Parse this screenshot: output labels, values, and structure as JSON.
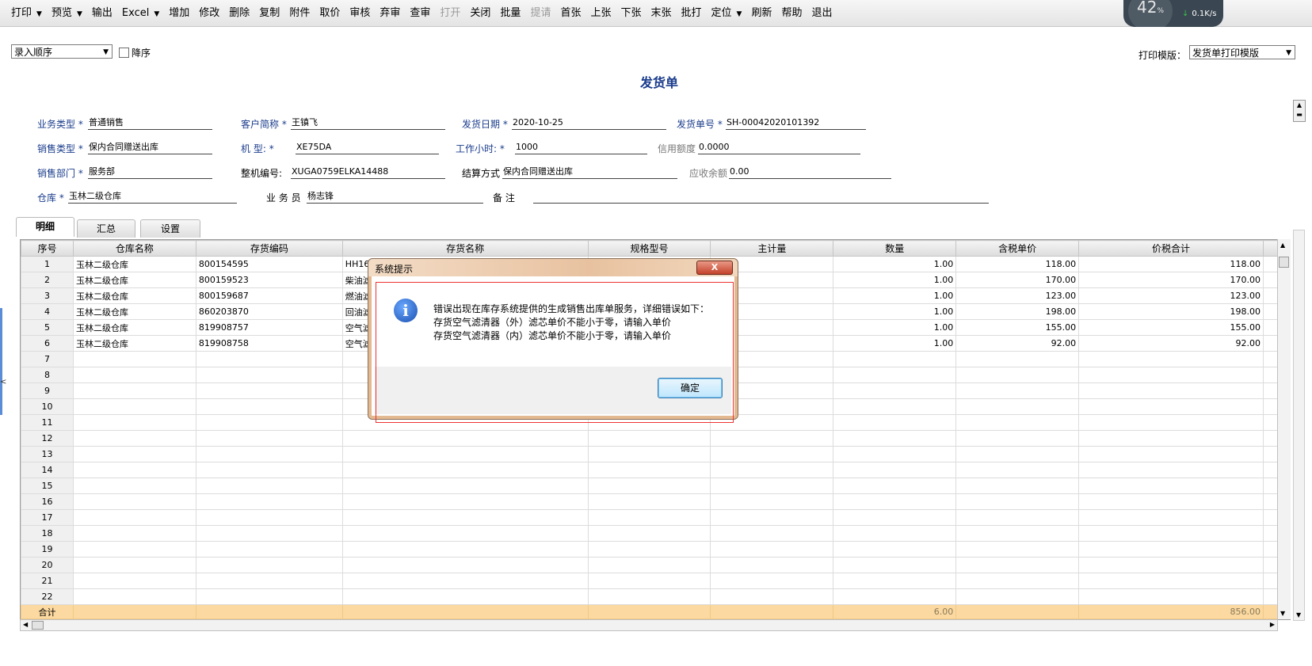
{
  "toolbar": {
    "items": [
      {
        "label": "打印",
        "dropdown": true,
        "disabled": false
      },
      {
        "label": "预览",
        "dropdown": true,
        "disabled": false
      },
      {
        "label": "输出",
        "dropdown": false,
        "disabled": false
      },
      {
        "label": "Excel",
        "dropdown": true,
        "disabled": false
      },
      {
        "label": "增加",
        "dropdown": false,
        "disabled": false
      },
      {
        "label": "修改",
        "dropdown": false,
        "disabled": false
      },
      {
        "label": "删除",
        "dropdown": false,
        "disabled": false
      },
      {
        "label": "复制",
        "dropdown": false,
        "disabled": false
      },
      {
        "label": "附件",
        "dropdown": false,
        "disabled": false
      },
      {
        "label": "取价",
        "dropdown": false,
        "disabled": false
      },
      {
        "label": "审核",
        "dropdown": false,
        "disabled": false
      },
      {
        "label": "弃审",
        "dropdown": false,
        "disabled": false
      },
      {
        "label": "查审",
        "dropdown": false,
        "disabled": false
      },
      {
        "label": "打开",
        "dropdown": false,
        "disabled": true
      },
      {
        "label": "关闭",
        "dropdown": false,
        "disabled": false
      },
      {
        "label": "批量",
        "dropdown": false,
        "disabled": false
      },
      {
        "label": "提请",
        "dropdown": false,
        "disabled": true
      },
      {
        "label": "首张",
        "dropdown": false,
        "disabled": false
      },
      {
        "label": "上张",
        "dropdown": false,
        "disabled": false
      },
      {
        "label": "下张",
        "dropdown": false,
        "disabled": false
      },
      {
        "label": "末张",
        "dropdown": false,
        "disabled": false
      },
      {
        "label": "批打",
        "dropdown": false,
        "disabled": false
      },
      {
        "label": "定位",
        "dropdown": true,
        "disabled": false
      },
      {
        "label": "刷新",
        "dropdown": false,
        "disabled": false
      },
      {
        "label": "帮助",
        "dropdown": false,
        "disabled": false
      },
      {
        "label": "退出",
        "dropdown": false,
        "disabled": false
      }
    ]
  },
  "speed_widget": {
    "percent": "42",
    "percent_unit": "%",
    "speed": "0.1K/s"
  },
  "header": {
    "sort_select": "录入顺序",
    "desc_checkbox": "降序",
    "title": "发货单",
    "print_template_label": "打印模版：",
    "print_template_value": "发货单打印模版"
  },
  "form": {
    "biz_type_label": "业务类型",
    "biz_type": "普通销售",
    "customer_label": "客户简称",
    "customer": "王镇飞",
    "ship_date_label": "发货日期",
    "ship_date": "2020-10-25",
    "ship_no_label": "发货单号",
    "ship_no": "SH-00042020101392",
    "sale_type_label": "销售类型",
    "sale_type": "保内合同赠送出库",
    "model_label": "机    型:",
    "model": "XE75DA",
    "hours_label": "工作小时:",
    "hours": "1000",
    "credit_label": "信用额度",
    "credit": "0.0000",
    "dept_label": "销售部门",
    "dept": "服务部",
    "machine_no_label": "整机编号:",
    "machine_no": "XUGA0759ELKA14488",
    "settle_label": "结算方式",
    "settle": "保内合同赠送出库",
    "receivable_label": "应收余额",
    "receivable": "0.00",
    "warehouse_label": "仓库",
    "warehouse": "玉林二级仓库",
    "staff_label": "业 务 员",
    "staff": "杨志锋",
    "remark_label": "备    注",
    "remark": ""
  },
  "tabs": [
    "明细",
    "汇总",
    "设置"
  ],
  "grid": {
    "columns": [
      "序号",
      "仓库名称",
      "存货编码",
      "存货名称",
      "规格型号",
      "主计量",
      "数量",
      "含税单价",
      "价税合计"
    ],
    "rows": [
      {
        "idx": "1",
        "wh": "玉林二级仓库",
        "code": "800154595",
        "name": "HH164",
        "spec": "",
        "unit": "",
        "qty": "1.00",
        "price": "118.00",
        "total": "118.00"
      },
      {
        "idx": "2",
        "wh": "玉林二级仓库",
        "code": "800159523",
        "name": "柴油滤",
        "spec": "",
        "unit": "",
        "qty": "1.00",
        "price": "170.00",
        "total": "170.00"
      },
      {
        "idx": "3",
        "wh": "玉林二级仓库",
        "code": "800159687",
        "name": "燃油滤",
        "spec": "",
        "unit": "",
        "qty": "1.00",
        "price": "123.00",
        "total": "123.00"
      },
      {
        "idx": "4",
        "wh": "玉林二级仓库",
        "code": "860203870",
        "name": "回油滤",
        "spec": "",
        "unit": "",
        "qty": "1.00",
        "price": "198.00",
        "total": "198.00"
      },
      {
        "idx": "5",
        "wh": "玉林二级仓库",
        "code": "819908757",
        "name": "空气滤",
        "spec": "",
        "unit": "",
        "qty": "1.00",
        "price": "155.00",
        "total": "155.00"
      },
      {
        "idx": "6",
        "wh": "玉林二级仓库",
        "code": "819908758",
        "name": "空气滤",
        "spec": "",
        "unit": "",
        "qty": "1.00",
        "price": "92.00",
        "total": "92.00"
      },
      {
        "idx": "7",
        "wh": "",
        "code": "",
        "name": "",
        "spec": "",
        "unit": "",
        "qty": "",
        "price": "",
        "total": ""
      },
      {
        "idx": "8",
        "wh": "",
        "code": "",
        "name": "",
        "spec": "",
        "unit": "",
        "qty": "",
        "price": "",
        "total": ""
      },
      {
        "idx": "9",
        "wh": "",
        "code": "",
        "name": "",
        "spec": "",
        "unit": "",
        "qty": "",
        "price": "",
        "total": ""
      },
      {
        "idx": "10",
        "wh": "",
        "code": "",
        "name": "",
        "spec": "",
        "unit": "",
        "qty": "",
        "price": "",
        "total": ""
      },
      {
        "idx": "11",
        "wh": "",
        "code": "",
        "name": "",
        "spec": "",
        "unit": "",
        "qty": "",
        "price": "",
        "total": ""
      },
      {
        "idx": "12",
        "wh": "",
        "code": "",
        "name": "",
        "spec": "",
        "unit": "",
        "qty": "",
        "price": "",
        "total": ""
      },
      {
        "idx": "13",
        "wh": "",
        "code": "",
        "name": "",
        "spec": "",
        "unit": "",
        "qty": "",
        "price": "",
        "total": ""
      },
      {
        "idx": "14",
        "wh": "",
        "code": "",
        "name": "",
        "spec": "",
        "unit": "",
        "qty": "",
        "price": "",
        "total": ""
      },
      {
        "idx": "15",
        "wh": "",
        "code": "",
        "name": "",
        "spec": "",
        "unit": "",
        "qty": "",
        "price": "",
        "total": ""
      },
      {
        "idx": "16",
        "wh": "",
        "code": "",
        "name": "",
        "spec": "",
        "unit": "",
        "qty": "",
        "price": "",
        "total": ""
      },
      {
        "idx": "17",
        "wh": "",
        "code": "",
        "name": "",
        "spec": "",
        "unit": "",
        "qty": "",
        "price": "",
        "total": ""
      },
      {
        "idx": "18",
        "wh": "",
        "code": "",
        "name": "",
        "spec": "",
        "unit": "",
        "qty": "",
        "price": "",
        "total": ""
      },
      {
        "idx": "19",
        "wh": "",
        "code": "",
        "name": "",
        "spec": "",
        "unit": "",
        "qty": "",
        "price": "",
        "total": ""
      },
      {
        "idx": "20",
        "wh": "",
        "code": "",
        "name": "",
        "spec": "",
        "unit": "",
        "qty": "",
        "price": "",
        "total": ""
      },
      {
        "idx": "21",
        "wh": "",
        "code": "",
        "name": "",
        "spec": "",
        "unit": "",
        "qty": "",
        "price": "",
        "total": ""
      },
      {
        "idx": "22",
        "wh": "",
        "code": "",
        "name": "",
        "spec": "",
        "unit": "",
        "qty": "",
        "price": "",
        "total": ""
      }
    ],
    "total_label": "合计",
    "total_qty": "6.00",
    "total_amount": "856.00"
  },
  "dialog": {
    "title": "系统提示",
    "close": "X",
    "icon": "info-icon",
    "lines": [
      "错误出现在库存系统提供的生成销售出库单服务，详细错误如下：",
      "存货空气滤清器（外）滤芯单价不能小于零，请输入单价",
      "存货空气滤清器（内）滤芯单价不能小于零，请输入单价"
    ],
    "ok": "确定"
  },
  "colors": {
    "title_blue": "#1a3c8c",
    "total_row": "#fbd9a0",
    "dialog_frame": "#e2b991",
    "outline_red": "#ee3333"
  }
}
